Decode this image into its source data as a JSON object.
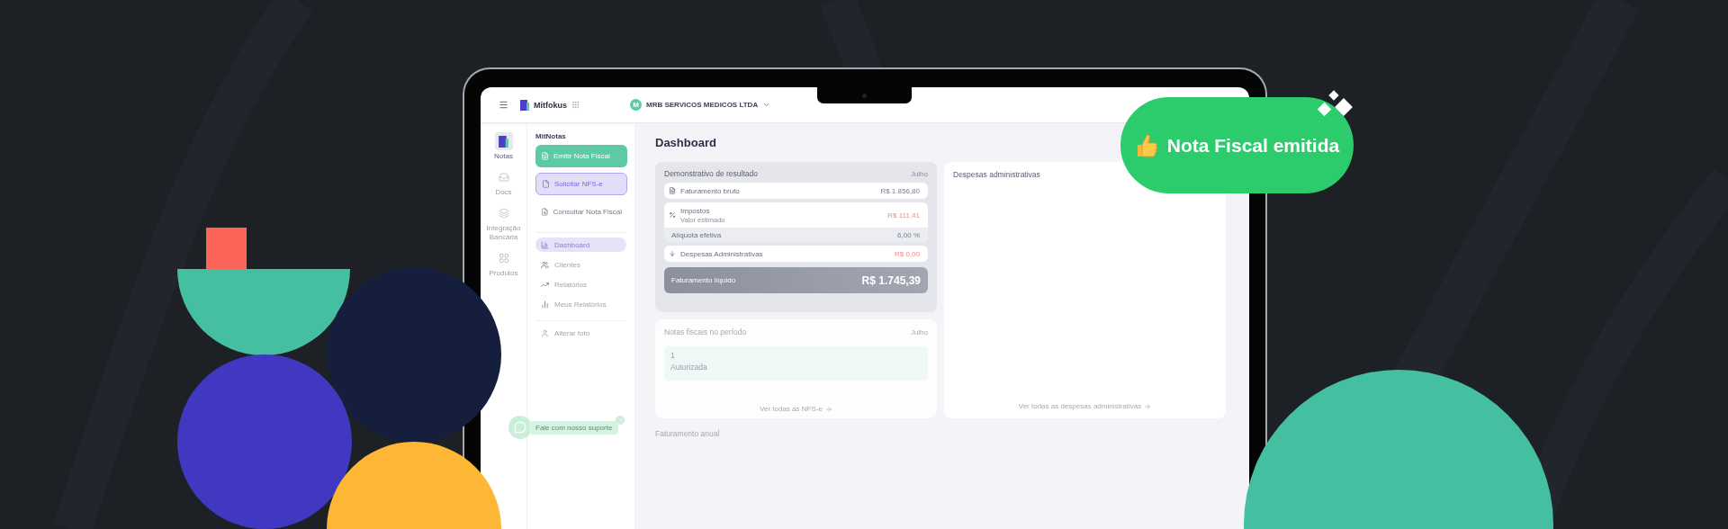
{
  "topbar": {
    "app_name": "Mitfokus",
    "company": {
      "initial": "M",
      "name": "MRB SERVICOS MEDICOS LTDA"
    }
  },
  "rail": [
    {
      "label": "Notas",
      "selected": true
    },
    {
      "label": "Docs",
      "selected": false
    },
    {
      "label": "Integração Bancária",
      "selected": false
    },
    {
      "label": "Produtos",
      "selected": false
    }
  ],
  "sidebar": {
    "title": "MitNotas",
    "actions": [
      {
        "kind": "primary",
        "label": "Emitir Nota Fiscal"
      },
      {
        "kind": "secondary",
        "label": "Solicitar NFS-e"
      },
      {
        "kind": "plain",
        "label": "Consultar Nota Fiscal"
      }
    ],
    "items": [
      {
        "label": "Dashboard",
        "selected": true
      },
      {
        "label": "Clientes",
        "selected": false
      },
      {
        "label": "Relatórios",
        "selected": false
      },
      {
        "label": "Meus Relatórios",
        "selected": false
      }
    ],
    "footer_item": "Alterar foto"
  },
  "page_title": "Dashboard",
  "result_card": {
    "title": "Demonstrativo de resultado",
    "period": "Julho",
    "gross": {
      "label": "Faturamento bruto",
      "value": "R$ 1.856,80"
    },
    "taxes": {
      "label": "Impostos",
      "note": "Valor estimado",
      "value": "R$ 111,41",
      "rate_label": "Alíquota efetiva",
      "rate": "6,00 %"
    },
    "expenses": {
      "label": "Despesas Administrativas",
      "value": "R$ 0,00"
    },
    "net": {
      "label": "Faturamento líquido",
      "value": "R$ 1.745,39"
    }
  },
  "expenses_card": {
    "title": "Despesas administrativas",
    "link": "Ver todas as despesas administrativas"
  },
  "invoices_card": {
    "title": "Notas fiscais no período",
    "period": "Julho",
    "count": "1",
    "status": "Autorizada",
    "link": "Ver todas as NFS-e"
  },
  "annual_title": "Faturamento anual",
  "support_chat": {
    "label": "Fale com nosso suporte"
  },
  "badge": {
    "label": "Nota Fiscal emitida"
  }
}
